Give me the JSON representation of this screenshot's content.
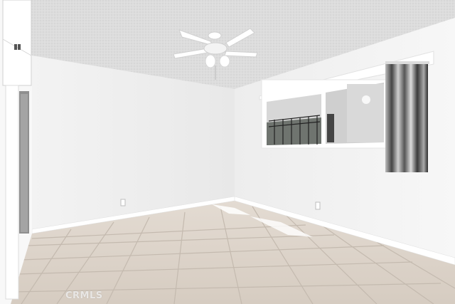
{
  "scene": {
    "description_type": "photo",
    "watermark": "CRMLS"
  },
  "colors": {
    "ceiling": "#dcdcdc",
    "wall_back": "#f0f0f0",
    "wall_right": "#f4f4f4",
    "wall_left": "#f7f7f7",
    "floor_tile": "#d9cfc4",
    "grout": "#bfb5aa",
    "baseboard": "#ffffff",
    "curtain_dark": "#3a3a3a"
  }
}
